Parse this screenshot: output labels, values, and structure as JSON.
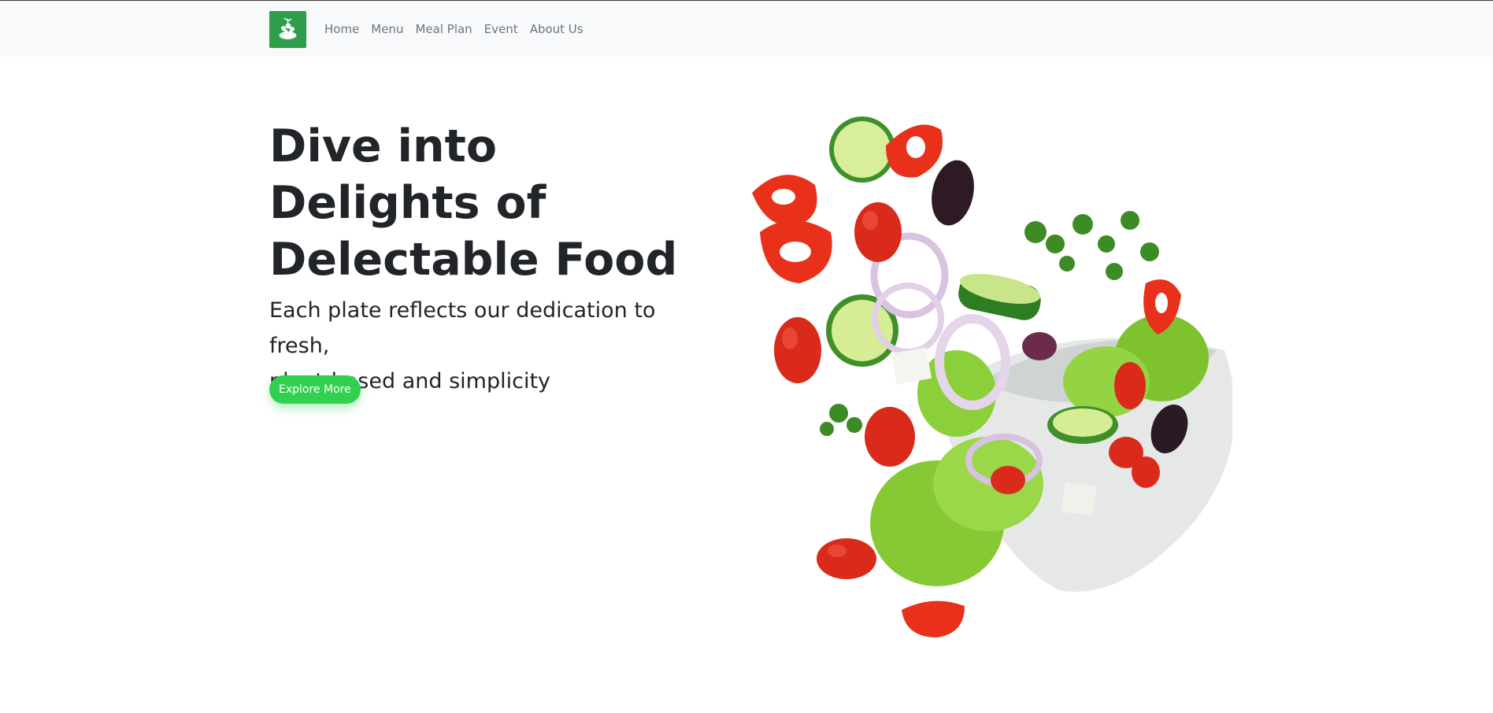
{
  "navbar": {
    "logo_icon": "salad-leaf-logo-icon",
    "links": [
      {
        "label": "Home"
      },
      {
        "label": "Menu"
      },
      {
        "label": "Meal Plan"
      },
      {
        "label": "Event"
      },
      {
        "label": "About Us"
      }
    ]
  },
  "hero": {
    "title_line1": "Dive into",
    "title_line2": "Delights of",
    "title_line3": "Delectable Food",
    "subtitle_line1": "Each plate reflects our dedication to fresh,",
    "subtitle_line2": "plant-based and simplicity",
    "cta_label": "Explore More",
    "image": "flying-salad-bowl-image"
  },
  "colors": {
    "accent": "#31d04f",
    "logo_bg": "#2e9e4d",
    "navbar_bg": "#f8f9fa",
    "text": "#212529",
    "nav_text": "#6c757d"
  }
}
